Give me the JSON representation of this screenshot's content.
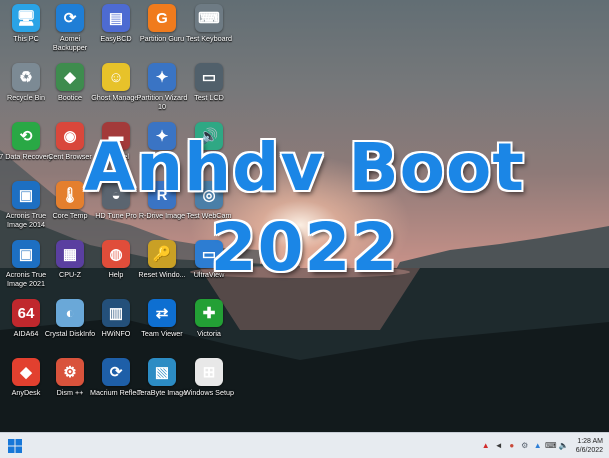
{
  "desktop": {
    "icons": [
      {
        "label": "This PC",
        "icon": "this-pc-icon",
        "glyph": "🖥",
        "color": "#2aa3e6"
      },
      {
        "label": "Aomei Backupper",
        "icon": "aomei-backupper-icon",
        "glyph": "⟳",
        "color": "#1f7ed6"
      },
      {
        "label": "EasyBCD",
        "icon": "easybcd-icon",
        "glyph": "▤",
        "color": "#4d6bd2"
      },
      {
        "label": "Partition Guru",
        "icon": "partition-guru-icon",
        "glyph": "G",
        "color": "#f07b1d"
      },
      {
        "label": "Test Keyboard",
        "icon": "keyboard-icon",
        "glyph": "⌨",
        "color": "#6e7b84"
      },
      {
        "label": "Recycle Bin",
        "icon": "recycle-bin-icon",
        "glyph": "♻",
        "color": "#7c8a94"
      },
      {
        "label": "Bootice",
        "icon": "bootice-icon",
        "glyph": "◆",
        "color": "#3e8c4e"
      },
      {
        "label": "Ghost Manager",
        "icon": "ghost-manager-icon",
        "glyph": "☺",
        "color": "#e7c22a"
      },
      {
        "label": "Partition Wizard 10",
        "icon": "partition-wizard-icon",
        "glyph": "✦",
        "color": "#3a74c4"
      },
      {
        "label": "Test LCD",
        "icon": "monitor-icon",
        "glyph": "▭",
        "color": "#51606b"
      },
      {
        "label": "7 Data Recovery",
        "icon": "data-recovery-icon",
        "glyph": "⟲",
        "color": "#29a845"
      },
      {
        "label": "Cent Browser",
        "icon": "cent-browser-icon",
        "glyph": "◉",
        "color": "#d9473b"
      },
      {
        "label": "Sentinel",
        "icon": "hard-disk-sentinel-icon",
        "glyph": "▬",
        "color": "#a33a3a"
      },
      {
        "label": "Wizard",
        "icon": "partition-wizard-2-icon",
        "glyph": "✦",
        "color": "#3a74c4"
      },
      {
        "label": "Sound",
        "icon": "speaker-icon",
        "glyph": "🔊",
        "color": "#2fa884"
      },
      {
        "label": "Acronis True Image 2014",
        "icon": "acronis-icon",
        "glyph": "▣",
        "color": "#1d6fc2"
      },
      {
        "label": "Core Temp",
        "icon": "core-temp-icon",
        "glyph": "🌡",
        "color": "#e47f2e"
      },
      {
        "label": "HD Tune Pro",
        "icon": "hd-tune-icon",
        "glyph": "◒",
        "color": "#5b6570"
      },
      {
        "label": "R-Drive Image",
        "icon": "r-drive-icon",
        "glyph": "R",
        "color": "#3a74c4"
      },
      {
        "label": "Test WebCam",
        "icon": "webcam-icon",
        "glyph": "◎",
        "color": "#4a7fa8"
      },
      {
        "label": "Acronis True Image 2021",
        "icon": "acronis-2021-icon",
        "glyph": "▣",
        "color": "#1d6fc2"
      },
      {
        "label": "CPU-Z",
        "icon": "cpu-z-icon",
        "glyph": "▦",
        "color": "#5a3fa0"
      },
      {
        "label": "Help",
        "icon": "help-lifebuoy-icon",
        "glyph": "◍",
        "color": "#e04d3a"
      },
      {
        "label": "Reset Windo...",
        "icon": "reset-password-icon",
        "glyph": "🔑",
        "color": "#c9a025"
      },
      {
        "label": "UltraView",
        "icon": "ultraviewer-icon",
        "glyph": "▭",
        "color": "#2d7dd2"
      },
      {
        "label": "AIDA64",
        "icon": "aida64-icon",
        "glyph": "64",
        "color": "#c0282d"
      },
      {
        "label": "Crystal DiskInfo",
        "icon": "crystal-diskinfo-icon",
        "glyph": "◐",
        "color": "#6aa8d8"
      },
      {
        "label": "HWiNFO",
        "icon": "hwinfo-icon",
        "glyph": "▥",
        "color": "#24507a"
      },
      {
        "label": "Team Viewer",
        "icon": "teamviewer-icon",
        "glyph": "⇄",
        "color": "#0e6fd1"
      },
      {
        "label": "Victoria",
        "icon": "victoria-icon",
        "glyph": "✚",
        "color": "#23a035"
      },
      {
        "label": "AnyDesk",
        "icon": "anydesk-icon",
        "glyph": "◆",
        "color": "#e2402f"
      },
      {
        "label": "Dism ++",
        "icon": "dism-icon",
        "glyph": "⚙",
        "color": "#d9533c"
      },
      {
        "label": "Macrium Reflect",
        "icon": "macrium-reflect-icon",
        "glyph": "⟳",
        "color": "#1e5fa8"
      },
      {
        "label": "TeraByte Image",
        "icon": "terabyte-image-icon",
        "glyph": "▧",
        "color": "#2c8cc4"
      },
      {
        "label": "Windows Setup",
        "icon": "windows-setup-icon",
        "glyph": "⊞",
        "color": "#e8e8e8"
      }
    ]
  },
  "banner": {
    "line1": "Anhdv Boot",
    "line2": "2022"
  },
  "taskbar": {
    "start_icon": "windows-start-icon",
    "tray": [
      {
        "icon": "tray-network-icon",
        "glyph": "▲",
        "color": "#d22b2b"
      },
      {
        "icon": "tray-volume-icon",
        "glyph": "◄",
        "color": "#3a3a3a"
      },
      {
        "icon": "tray-app-icon",
        "glyph": "●",
        "color": "#c94a3a"
      },
      {
        "icon": "tray-settings-icon",
        "glyph": "⚙",
        "color": "#5a6470"
      },
      {
        "icon": "tray-notification-icon",
        "glyph": "▲",
        "color": "#2f7fd6"
      },
      {
        "icon": "tray-keyboard-icon",
        "glyph": "⌨",
        "color": "#3a3a3a"
      },
      {
        "icon": "tray-speaker-icon",
        "glyph": "🔈",
        "color": "#3a3a3a"
      }
    ],
    "time": "1:28 AM",
    "date": "6/6/2022"
  }
}
